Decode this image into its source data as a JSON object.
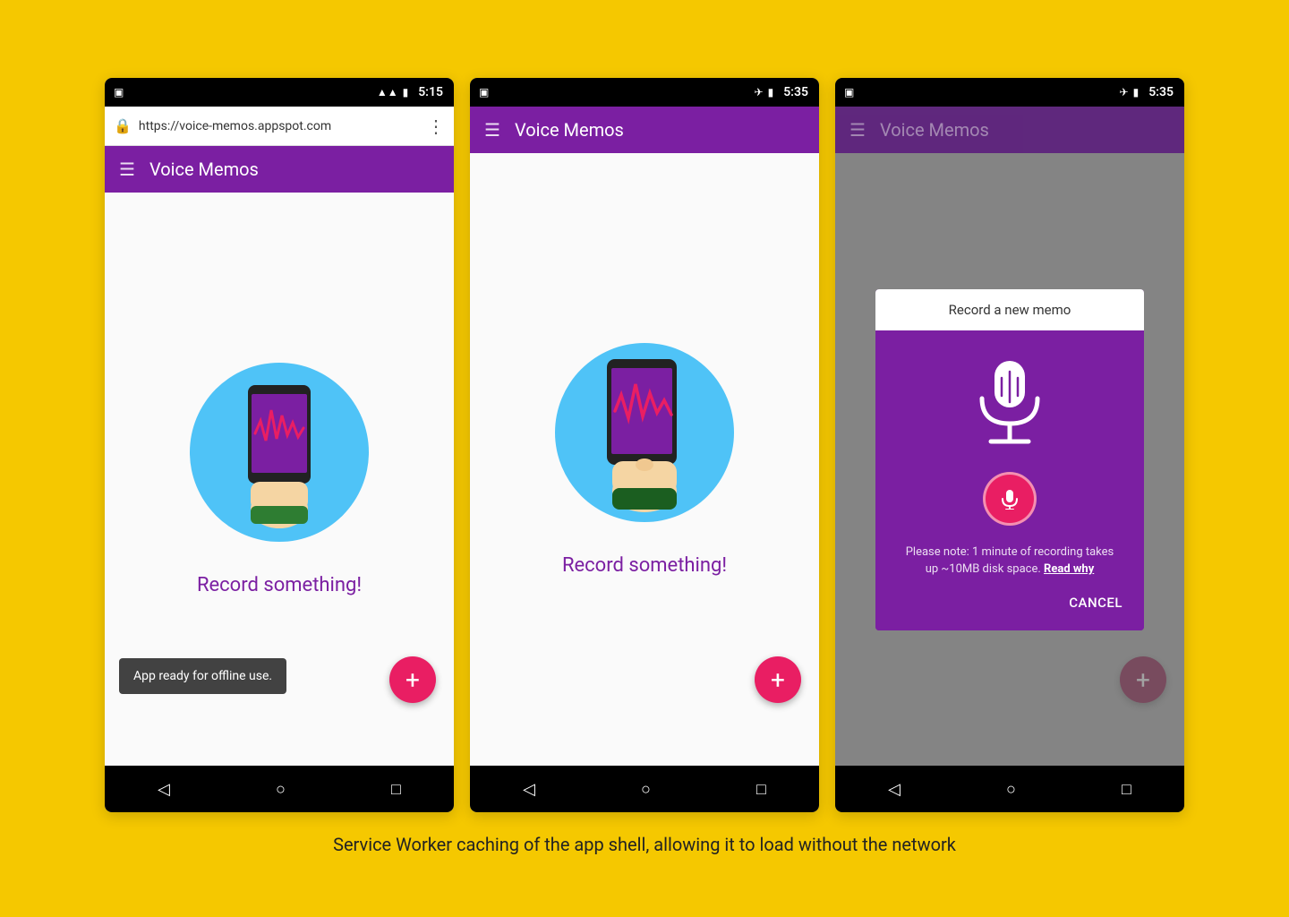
{
  "background_color": "#F5C800",
  "caption": "Service Worker caching of the app shell, allowing it to load without the network",
  "phones": [
    {
      "id": "phone1",
      "type": "browser",
      "status_bar": {
        "time": "5:15",
        "has_sim": true,
        "has_signal": true,
        "has_battery": true,
        "has_airplane": false
      },
      "url_bar": {
        "url": "https://voice-memos.appspot.com",
        "secure": true
      },
      "app_bar": {
        "title": "Voice Memos"
      },
      "content": {
        "record_label": "Record something!",
        "show_toast": true,
        "toast_text": "App ready for offline use."
      }
    },
    {
      "id": "phone2",
      "type": "app",
      "status_bar": {
        "time": "5:35",
        "has_sim": true,
        "has_signal": false,
        "has_battery": true,
        "has_airplane": true
      },
      "app_bar": {
        "title": "Voice Memos"
      },
      "content": {
        "record_label": "Record something!",
        "show_toast": false,
        "toast_text": ""
      }
    },
    {
      "id": "phone3",
      "type": "app",
      "status_bar": {
        "time": "5:35",
        "has_sim": true,
        "has_signal": false,
        "has_battery": true,
        "has_airplane": true
      },
      "app_bar": {
        "title": "Voice Memos"
      },
      "content": {
        "record_label": "",
        "show_toast": false,
        "toast_text": "",
        "show_dialog": true
      },
      "dialog": {
        "title": "Record a new memo",
        "note": "Please note: 1 minute of recording takes up ~10MB disk space.",
        "note_link": "Read why",
        "cancel_label": "CANCEL"
      }
    }
  ]
}
